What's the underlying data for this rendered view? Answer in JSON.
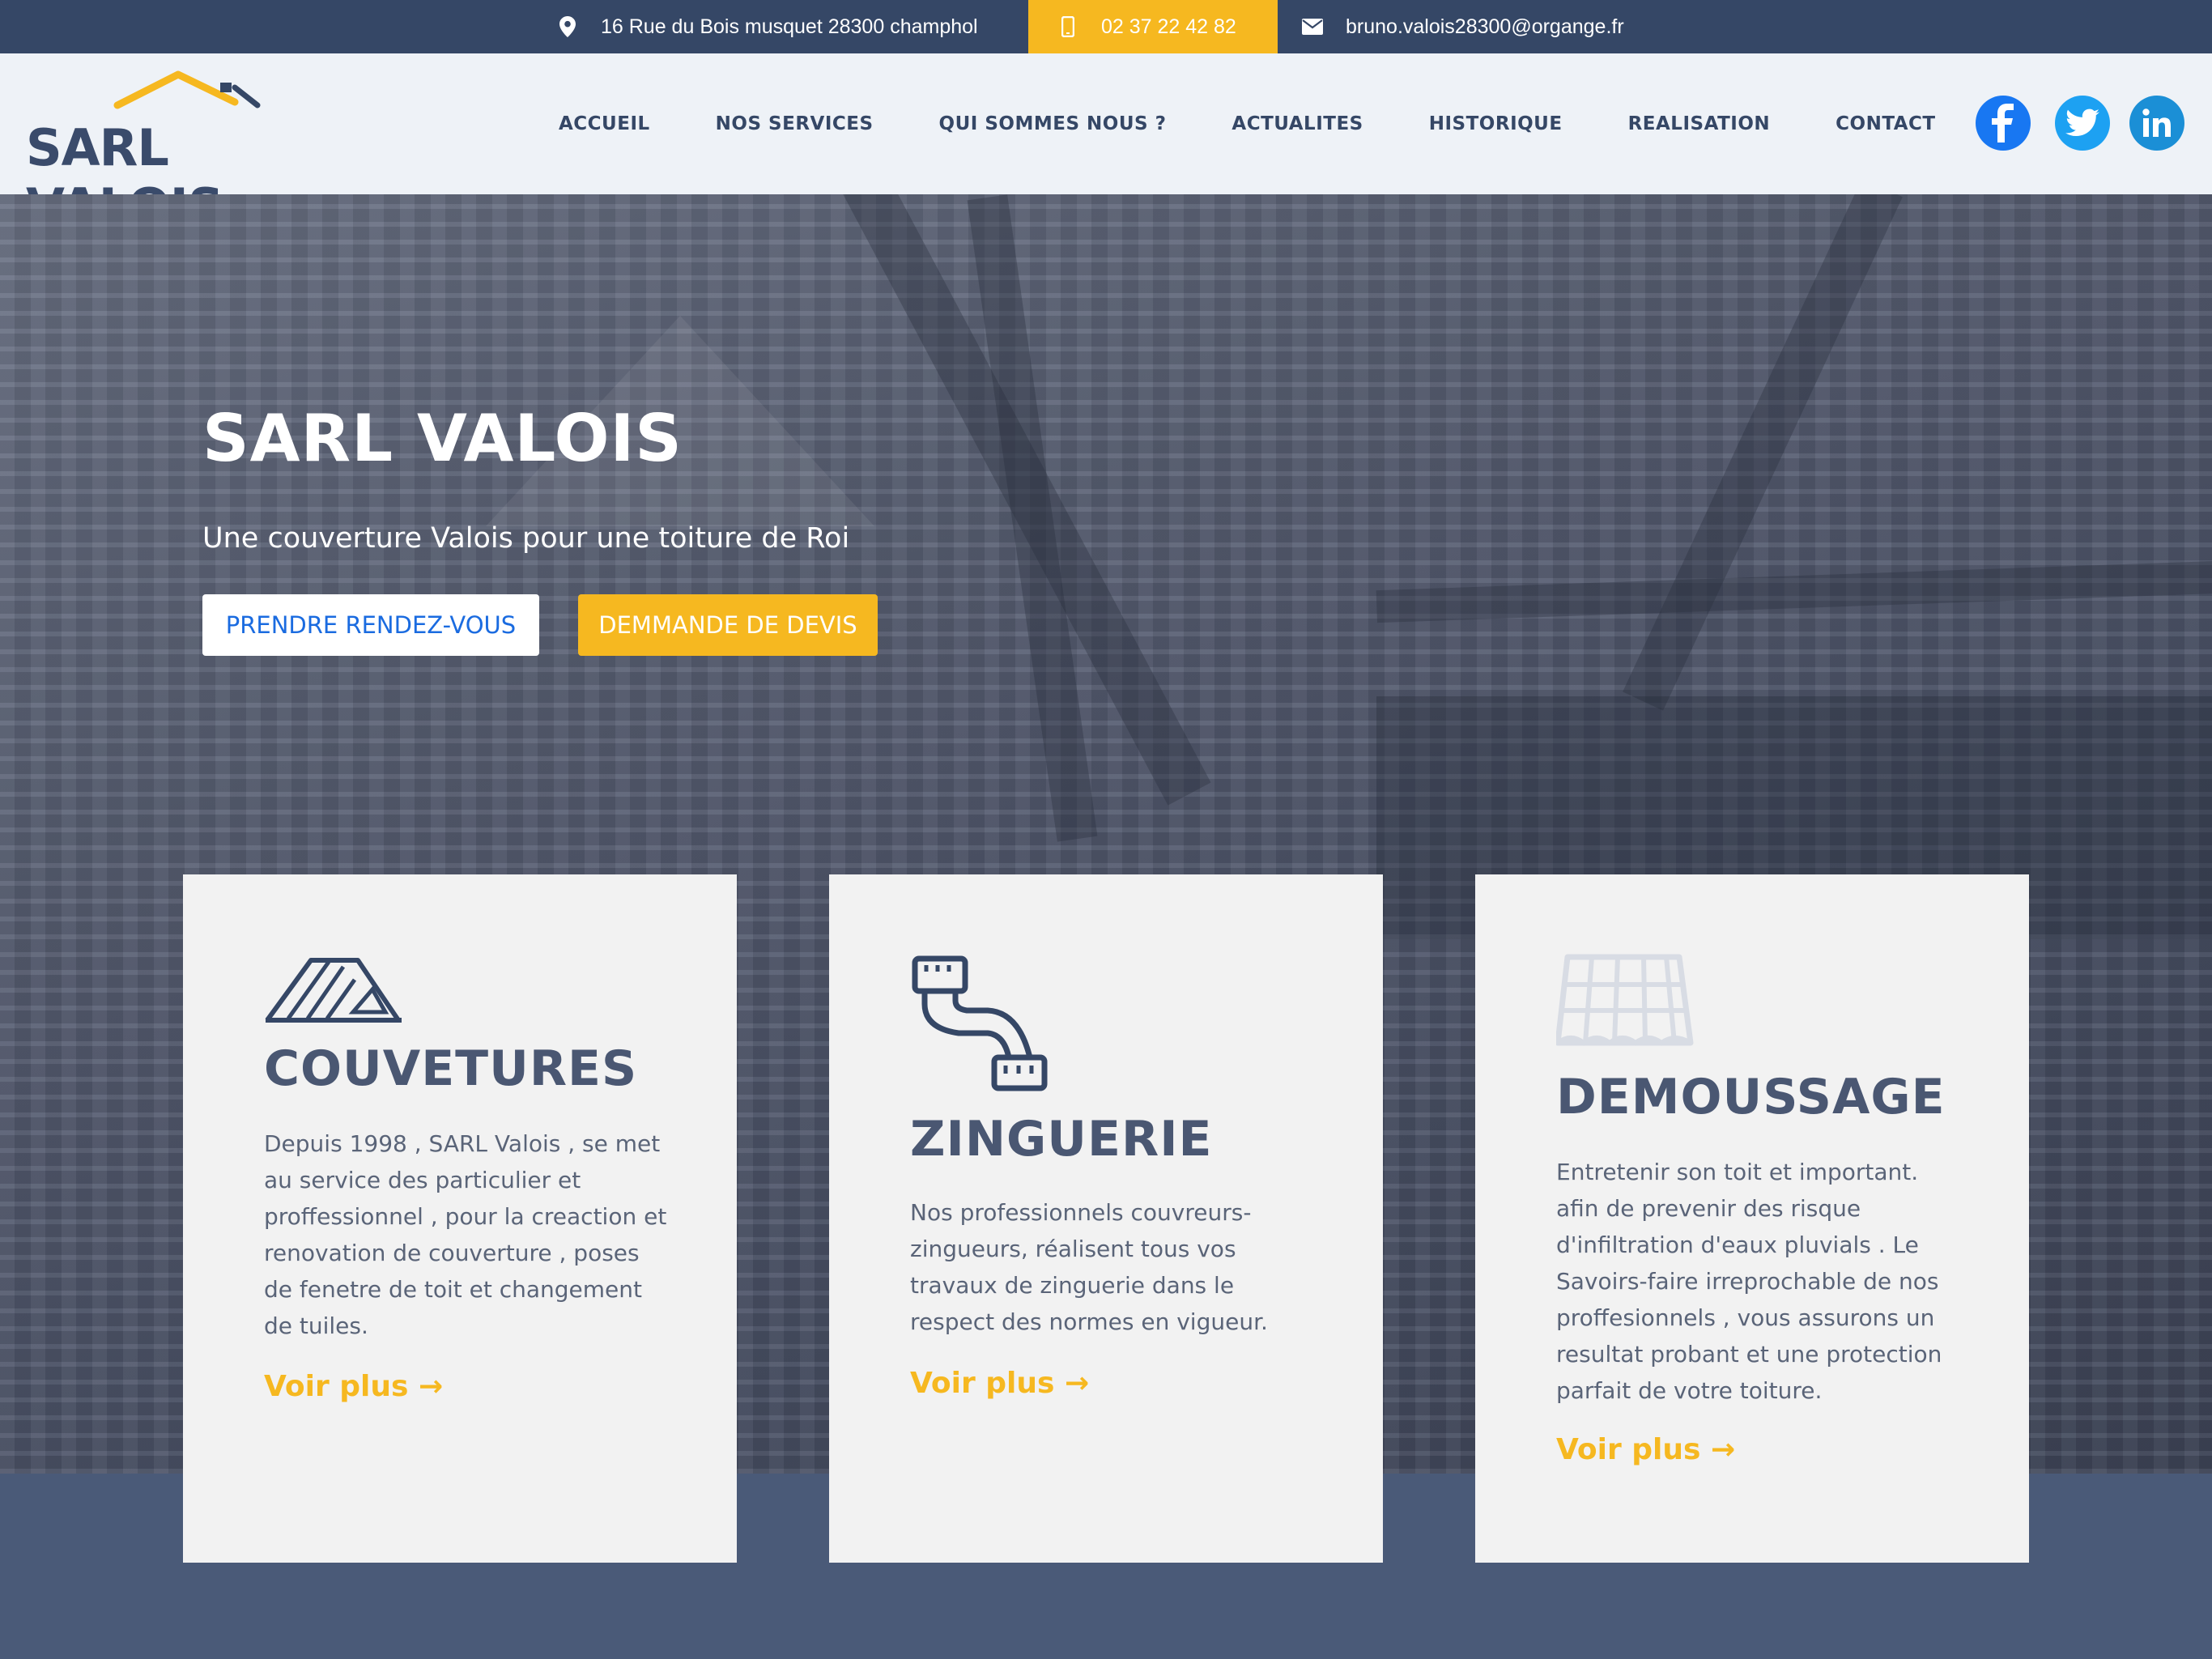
{
  "topbar": {
    "address": "16 Rue du Bois musquet 28300 champhol",
    "phone": "02 37 22 42 82",
    "email": "bruno.valois28300@organge.fr"
  },
  "header": {
    "logo_text": "SARL VALOIS",
    "nav": [
      "ACCUEIL",
      "NOS SERVICES",
      "QUI SOMMES NOUS ?",
      "ACTUALITES",
      "HISTORIQUE",
      "REALISATION",
      "CONTACT"
    ],
    "social": [
      "facebook-icon",
      "twitter-icon",
      "linkedin-icon"
    ]
  },
  "hero": {
    "title": "SARL VALOIS",
    "tagline": "Une couverture Valois pour une toiture de Roi",
    "btn_rdv": "PRENDRE RENDEZ-VOUS",
    "btn_devis": "DEMMANDE DE DEVIS"
  },
  "cards": [
    {
      "icon": "roof-icon",
      "title": "COUVETURES",
      "text": "Depuis 1998 , SARL Valois , se met au service des particulier et proffessionnel , pour la creaction et renovation de couverture , poses de fenetre de toit et changement de tuiles.",
      "more": "Voir plus →"
    },
    {
      "icon": "pipe-icon",
      "title": "ZINGUERIE",
      "text": "Nos professionnels couvreurs-zingueurs, réalisent tous vos travaux de zinguerie dans le respect des normes en vigueur.",
      "more": "Voir plus →"
    },
    {
      "icon": "tiles-icon",
      "title": "DEMOUSSAGE",
      "text": "Entretenir son toit et important. afin de prevenir des risque d'infiltration d'eaux pluvials . Le Savoirs-faire irreprochable de nos proffesionnels , vous assurons un resultat probant et une protection parfait de votre toiture.",
      "more": "Voir plus →"
    }
  ],
  "colors": {
    "navy": "#354766",
    "accent": "#f6b820",
    "band": "#4a5a78"
  }
}
